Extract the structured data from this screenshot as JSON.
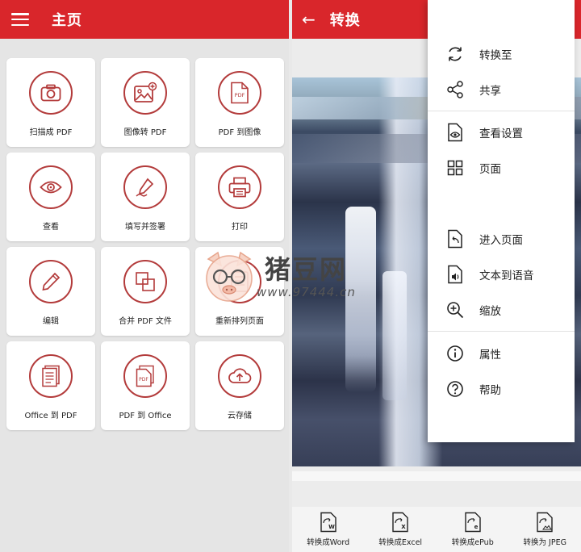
{
  "left_screen": {
    "title": "主页",
    "tiles": [
      {
        "label": "扫描成 PDF",
        "icon": "camera-icon"
      },
      {
        "label": "图像转 PDF",
        "icon": "image-add-icon"
      },
      {
        "label": "PDF 到图像",
        "icon": "pdf-file-icon",
        "badge": "PDF"
      },
      {
        "label": "查看",
        "icon": "eye-icon"
      },
      {
        "label": "填写并签署",
        "icon": "signature-pen-icon"
      },
      {
        "label": "打印",
        "icon": "printer-icon"
      },
      {
        "label": "编辑",
        "icon": "pencil-icon"
      },
      {
        "label": "合并 PDF 文件",
        "icon": "merge-squares-icon"
      },
      {
        "label": "重新排列页面",
        "icon": "reorder-pages-icon"
      },
      {
        "label": "Office 到 PDF",
        "icon": "document-lines-icon"
      },
      {
        "label": "PDF 到 Office",
        "icon": "pdf-stack-icon",
        "badge": "PDF"
      },
      {
        "label": "云存储",
        "icon": "cloud-upload-icon"
      }
    ]
  },
  "right_screen": {
    "title": "转换",
    "menu": {
      "items": [
        {
          "label": "转换至",
          "icon": "convert-sync-icon"
        },
        {
          "label": "共享",
          "icon": "share-icon"
        },
        {
          "label": "查看设置",
          "icon": "view-settings-icon"
        },
        {
          "label": "页面",
          "icon": "pages-grid-icon"
        },
        {
          "label": "进入页面",
          "icon": "goto-page-icon"
        },
        {
          "label": "文本到语音",
          "icon": "text-to-speech-icon"
        },
        {
          "label": "缩放",
          "icon": "zoom-in-icon"
        },
        {
          "label": "属性",
          "icon": "info-icon"
        },
        {
          "label": "帮助",
          "icon": "help-icon"
        }
      ]
    },
    "bottom_actions": [
      {
        "label": "转换成Word",
        "icon": "convert-word-icon",
        "letter": "W"
      },
      {
        "label": "转换成Excel",
        "icon": "convert-excel-icon",
        "letter": "X"
      },
      {
        "label": "转换成ePub",
        "icon": "convert-epub-icon",
        "letter": "e"
      },
      {
        "label": "转换为 JPEG",
        "icon": "convert-jpeg-icon",
        "letter": ""
      }
    ]
  },
  "watermark": {
    "brand": "猪豆网",
    "url": "www.97444.cn"
  },
  "colors": {
    "primary": "#d9262b",
    "icon_stroke": "#b33b3b"
  }
}
